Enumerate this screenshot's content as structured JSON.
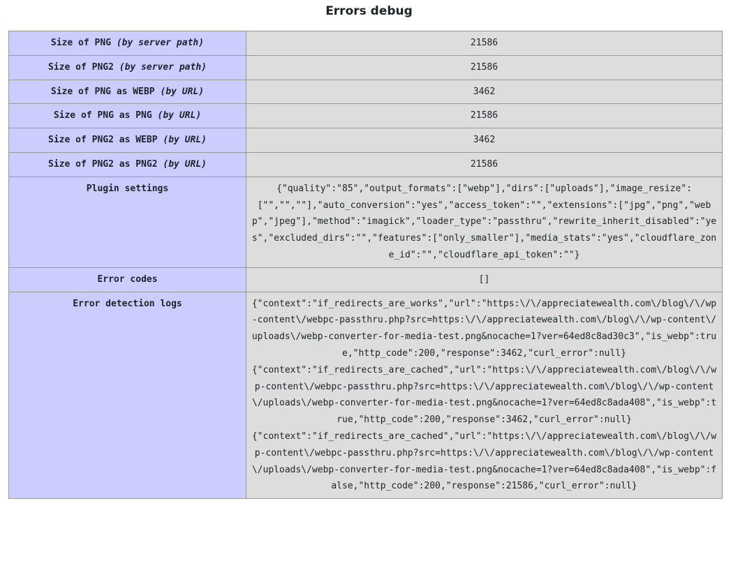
{
  "page": {
    "title": "Errors debug"
  },
  "rows": [
    {
      "label": "Size of PNG ",
      "label_em": "(by server path)",
      "value": "21586"
    },
    {
      "label": "Size of PNG2 ",
      "label_em": "(by server path)",
      "value": "21586"
    },
    {
      "label": "Size of PNG as WEBP ",
      "label_em": "(by URL)",
      "value": "3462"
    },
    {
      "label": "Size of PNG as PNG ",
      "label_em": "(by URL)",
      "value": "21586"
    },
    {
      "label": "Size of PNG2 as WEBP ",
      "label_em": "(by URL)",
      "value": "3462"
    },
    {
      "label": "Size of PNG2 as PNG2 ",
      "label_em": "(by URL)",
      "value": "21586"
    }
  ],
  "plugin_settings": {
    "label": "Plugin settings",
    "value": "{\"quality\":\"85\",\"output_formats\":[\"webp\"],\"dirs\":[\"uploads\"],\"image_resize\":[\"\",\"\",\"\"],\"auto_conversion\":\"yes\",\"access_token\":\"\",\"extensions\":[\"jpg\",\"png\",\"webp\",\"jpeg\"],\"method\":\"imagick\",\"loader_type\":\"passthru\",\"rewrite_inherit_disabled\":\"yes\",\"excluded_dirs\":\"\",\"features\":[\"only_smaller\"],\"media_stats\":\"yes\",\"cloudflare_zone_id\":\"\",\"cloudflare_api_token\":\"\"}"
  },
  "error_codes": {
    "label": "Error codes",
    "value": "[]"
  },
  "error_logs": {
    "label": "Error detection logs",
    "entries": [
      "{\"context\":\"if_redirects_are_works\",\"url\":\"https:\\/\\/appreciatewealth.com\\/blog\\/\\/wp-content\\/webpc-passthru.php?src=https:\\/\\/appreciatewealth.com\\/blog\\/\\/wp-content\\/uploads\\/webp-converter-for-media-test.png&nocache=1?ver=64ed8c8ad30c3\",\"is_webp\":true,\"http_code\":200,\"response\":3462,\"curl_error\":null}",
      "{\"context\":\"if_redirects_are_cached\",\"url\":\"https:\\/\\/appreciatewealth.com\\/blog\\/\\/wp-content\\/webpc-passthru.php?src=https:\\/\\/appreciatewealth.com\\/blog\\/\\/wp-content\\/uploads\\/webp-converter-for-media-test.png&nocache=1?ver=64ed8c8ada408\",\"is_webp\":true,\"http_code\":200,\"response\":3462,\"curl_error\":null}",
      "{\"context\":\"if_redirects_are_cached\",\"url\":\"https:\\/\\/appreciatewealth.com\\/blog\\/\\/wp-content\\/webpc-passthru.php?src=https:\\/\\/appreciatewealth.com\\/blog\\/\\/wp-content\\/uploads\\/webp-converter-for-media-test.png&nocache=1?ver=64ed8c8ada408\",\"is_webp\":false,\"http_code\":200,\"response\":21586,\"curl_error\":null}"
    ]
  }
}
